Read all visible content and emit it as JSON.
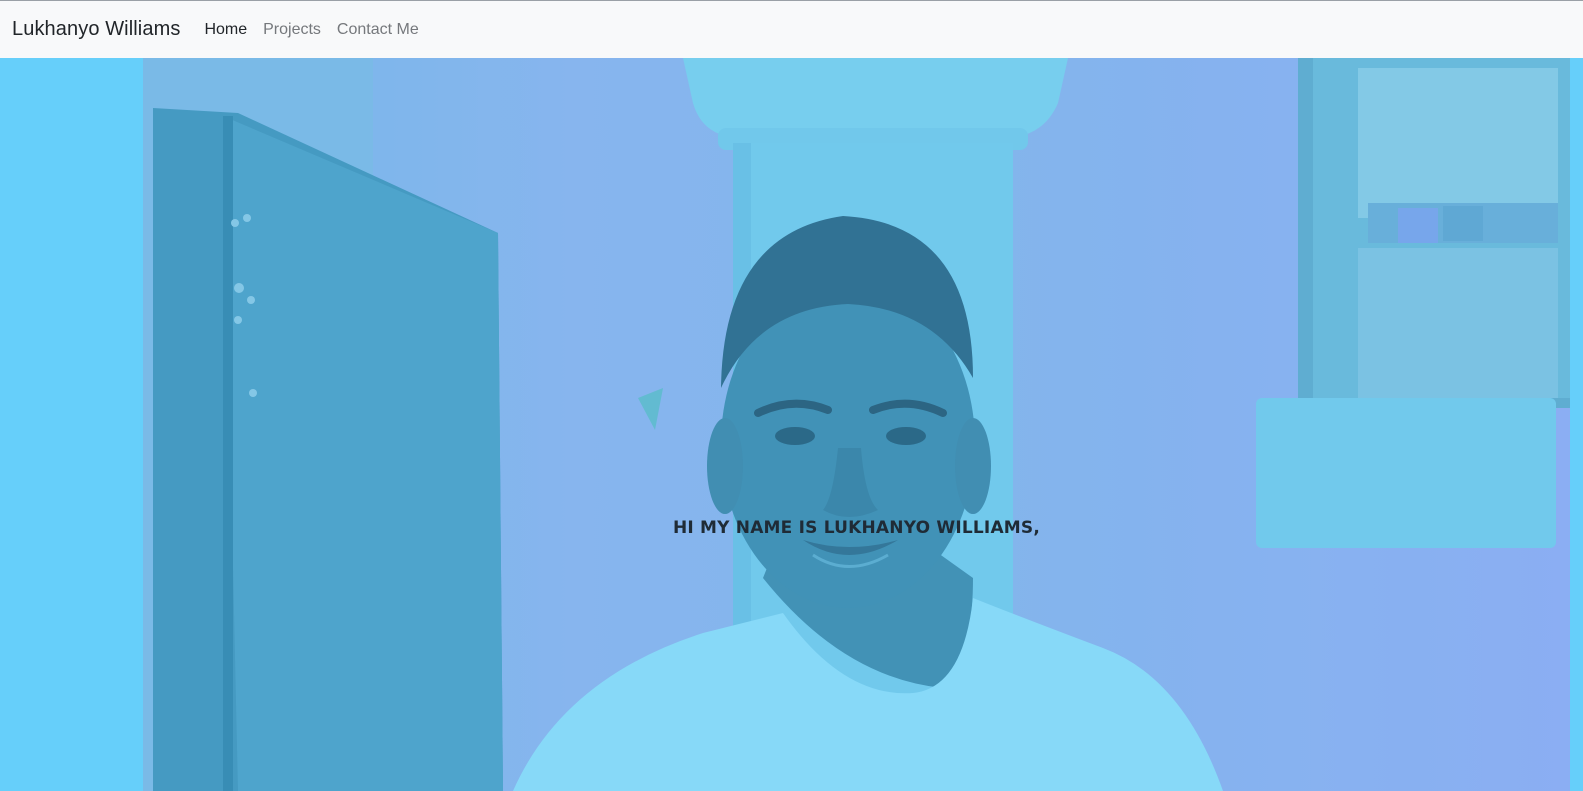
{
  "navbar": {
    "brand": "Lukhanyo Williams",
    "links": [
      {
        "label": "Home",
        "active": true
      },
      {
        "label": "Projects",
        "active": false
      },
      {
        "label": "Contact Me",
        "active": false
      }
    ]
  },
  "hero": {
    "greeting": "HI MY NAME IS LUKHANYO WILLIAMS,",
    "overlay_color": "#66cffa"
  }
}
